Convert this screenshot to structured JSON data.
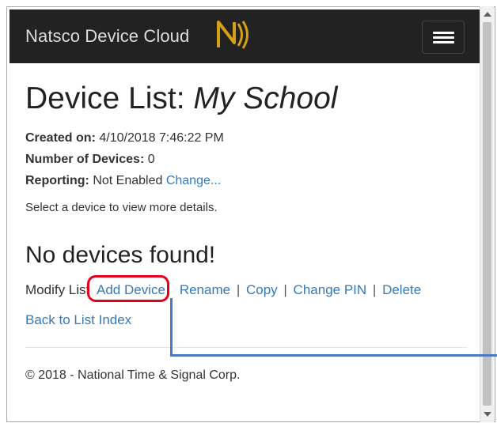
{
  "navbar": {
    "brand": "Natsco Device Cloud",
    "logo_icon": "natsco-n-logo",
    "menu_icon": "hamburger-icon"
  },
  "header": {
    "title_prefix": "Device List: ",
    "title_name": "My School"
  },
  "meta": {
    "created_label": "Created on:",
    "created_value": " 4/10/2018 7:46:22 PM",
    "count_label": "Number of Devices:",
    "count_value": " 0",
    "reporting_label": "Reporting:",
    "reporting_value": " Not Enabled ",
    "reporting_link": "Change..."
  },
  "hint": "Select a device to view more details.",
  "empty_heading": "No devices found!",
  "actions": {
    "label": "Modify List",
    "add": "Add Device",
    "rename": "Rename",
    "copy": "Copy",
    "change_pin": "Change PIN",
    "delete": "Delete",
    "separator": "|"
  },
  "back_link": "Back to List Index",
  "footer": "© 2018 - National Time & Signal Corp.",
  "colors": {
    "navbar": "#222222",
    "link": "#337ab7",
    "highlight": "#e4001b",
    "callout": "#4a7ac4",
    "logo": "#d4a017"
  }
}
